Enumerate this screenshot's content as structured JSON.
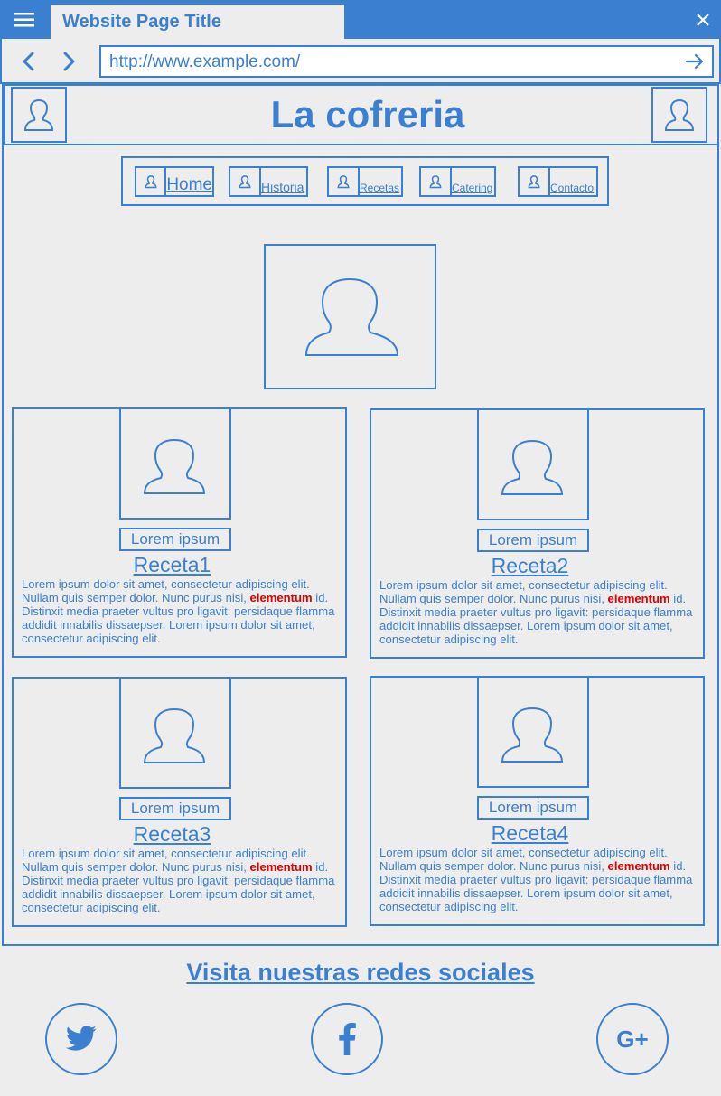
{
  "browser": {
    "tab_title": "Website Page Title",
    "url": "http://www.example.com/"
  },
  "header": {
    "title": "La cofreria"
  },
  "nav": {
    "items": [
      {
        "label": "Home"
      },
      {
        "label": "Historia"
      },
      {
        "label": "Recetas"
      },
      {
        "label": "Catering"
      },
      {
        "label": "Contacto"
      }
    ]
  },
  "cards": [
    {
      "caption": "Lorem ipsum",
      "title": "Receta1",
      "body_1": "Lorem ipsum dolor sit amet, consectetur adipiscing elit. Nullam quis semper dolor. Nunc purus nisi, ",
      "highlight": "elementum",
      "body_2": " id. Distinxit  media praeter vultus pro ligavit: persidaque flamma addidit innabilis dissaepser. Lorem ipsum dolor sit amet, consectetur adipiscing elit."
    },
    {
      "caption": "Lorem ipsum",
      "title": "Receta2",
      "body_1": "Lorem ipsum dolor sit amet, consectetur adipiscing elit. Nullam quis semper dolor. Nunc purus nisi, ",
      "highlight": "elementum",
      "body_2": " id. Distinxit  media praeter vultus pro ligavit: persidaque flamma addidit innabilis dissaepser. Lorem ipsum dolor sit amet, consectetur adipiscing elit."
    },
    {
      "caption": "Lorem ipsum",
      "title": "Receta3",
      "body_1": "Lorem ipsum dolor sit amet, consectetur adipiscing elit. Nullam quis semper dolor. Nunc purus nisi, ",
      "highlight": "elementum",
      "body_2": " id. Distinxit  media praeter vultus pro ligavit: persidaque flamma addidit innabilis dissaepser. Lorem ipsum dolor sit amet, consectetur adipiscing elit."
    },
    {
      "caption": "Lorem ipsum",
      "title": "Receta4",
      "body_1": "Lorem ipsum dolor sit amet, consectetur adipiscing elit. Nullam quis semper dolor. Nunc purus nisi, ",
      "highlight": "elementum",
      "body_2": " id. Distinxit  media praeter vultus pro ligavit: persidaque flamma addidit innabilis dissaepser. Lorem ipsum dolor sit amet, consectetur adipiscing elit."
    }
  ],
  "footer": {
    "title": "Visita nuestras redes sociales",
    "gplus_label": "G+"
  },
  "icons": {
    "menu": "hamburger-icon",
    "close": "close-icon",
    "back": "chevron-left-icon",
    "forward": "chevron-right-icon",
    "go": "arrow-right-icon",
    "avatar": "user-icon",
    "twitter": "twitter-icon",
    "facebook": "facebook-icon",
    "gplus": "google-plus-icon"
  },
  "colors": {
    "accent": "#3b7fd0",
    "highlight": "#e00000",
    "background": "#ededed"
  }
}
